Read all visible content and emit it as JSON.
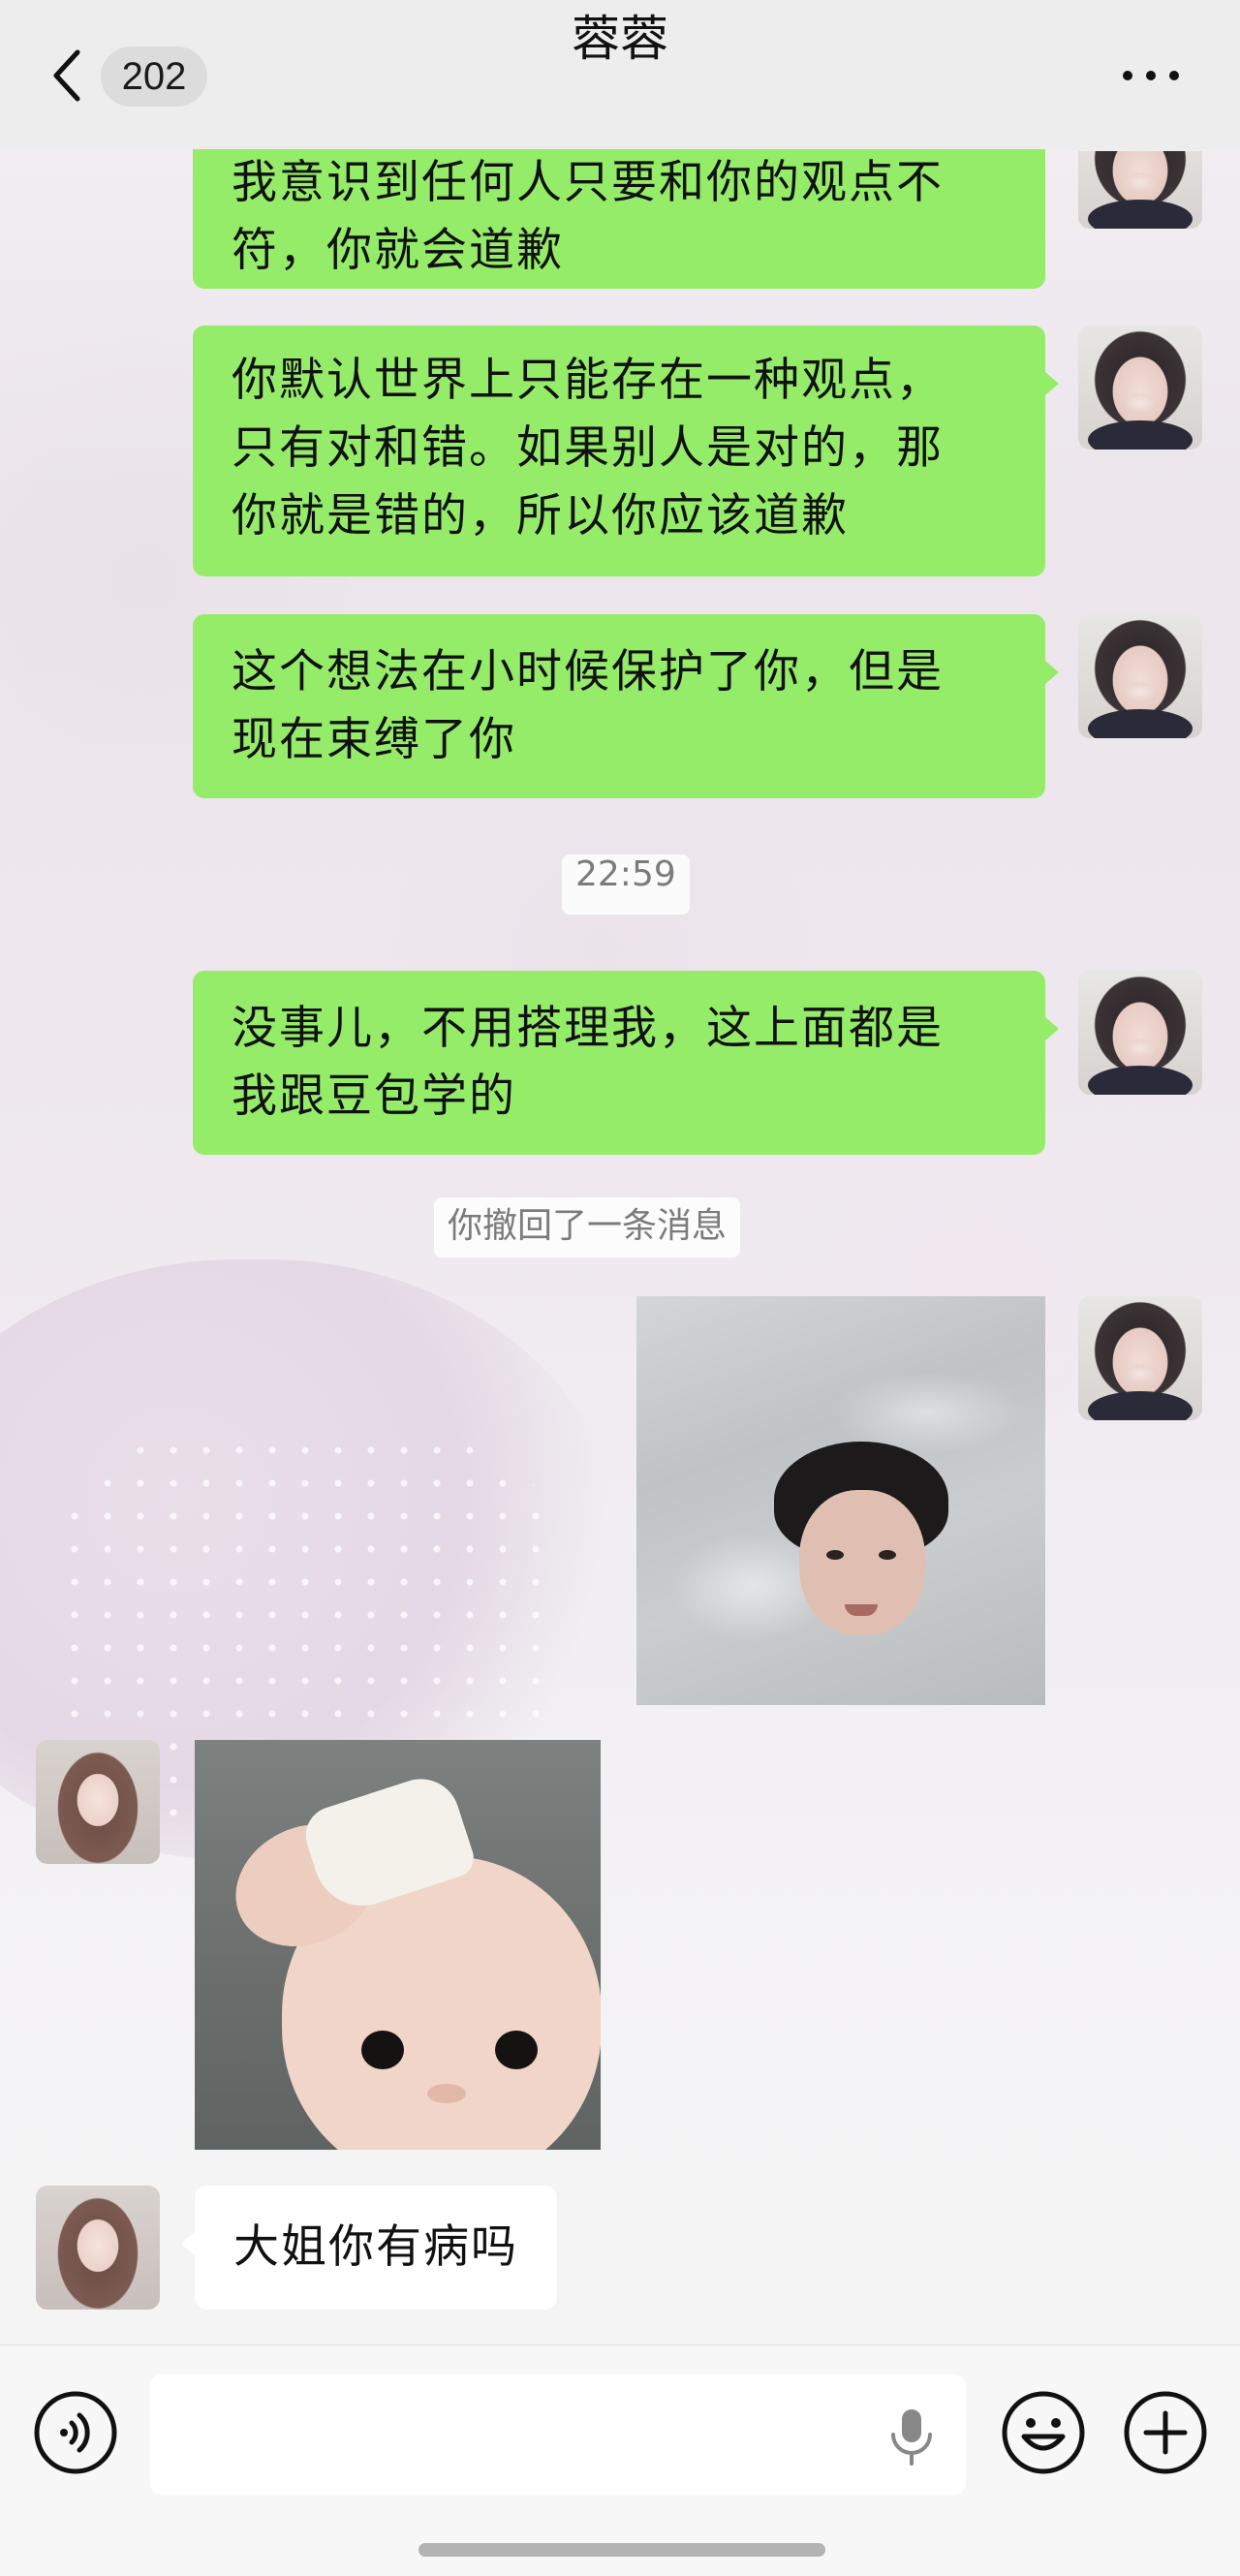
{
  "header": {
    "back_count": "202",
    "title": "蓉蓉"
  },
  "messages": [
    {
      "side": "right",
      "text_lines": [
        "我意识到任何人只要和你的观点不",
        "符，你就会道歉"
      ]
    },
    {
      "side": "right",
      "text_lines": [
        "你默认世界上只能存在一种观点，",
        "只有对和错。如果别人是对的，那",
        "你就是错的，所以你应该道歉"
      ]
    },
    {
      "side": "right",
      "text_lines": [
        "这个想法在小时候保护了你，但是",
        "现在束缚了你"
      ]
    },
    {
      "timestamp": "22:59"
    },
    {
      "side": "right",
      "text_lines": [
        "没事儿，不用搭理我，这上面都是",
        "我跟豆包学的"
      ]
    },
    {
      "system": "你撤回了一条消息"
    },
    {
      "side": "right",
      "image": "photo of boy in bathtub water"
    },
    {
      "side": "left",
      "image": "photo of baby holding cloth on forehead"
    },
    {
      "side": "left",
      "text_lines": [
        "大姐你有病吗"
      ]
    }
  ],
  "input": {
    "value": ""
  },
  "icons": {
    "back": "chevron-left-icon",
    "more": "more-dots-icon",
    "voice": "voice-icon",
    "mic": "mic-icon",
    "emoji": "emoji-icon",
    "plus": "plus-icon"
  },
  "colors": {
    "sent_bubble": "#95ec69",
    "received_bubble": "#ffffff",
    "header_bg": "#ededed"
  }
}
